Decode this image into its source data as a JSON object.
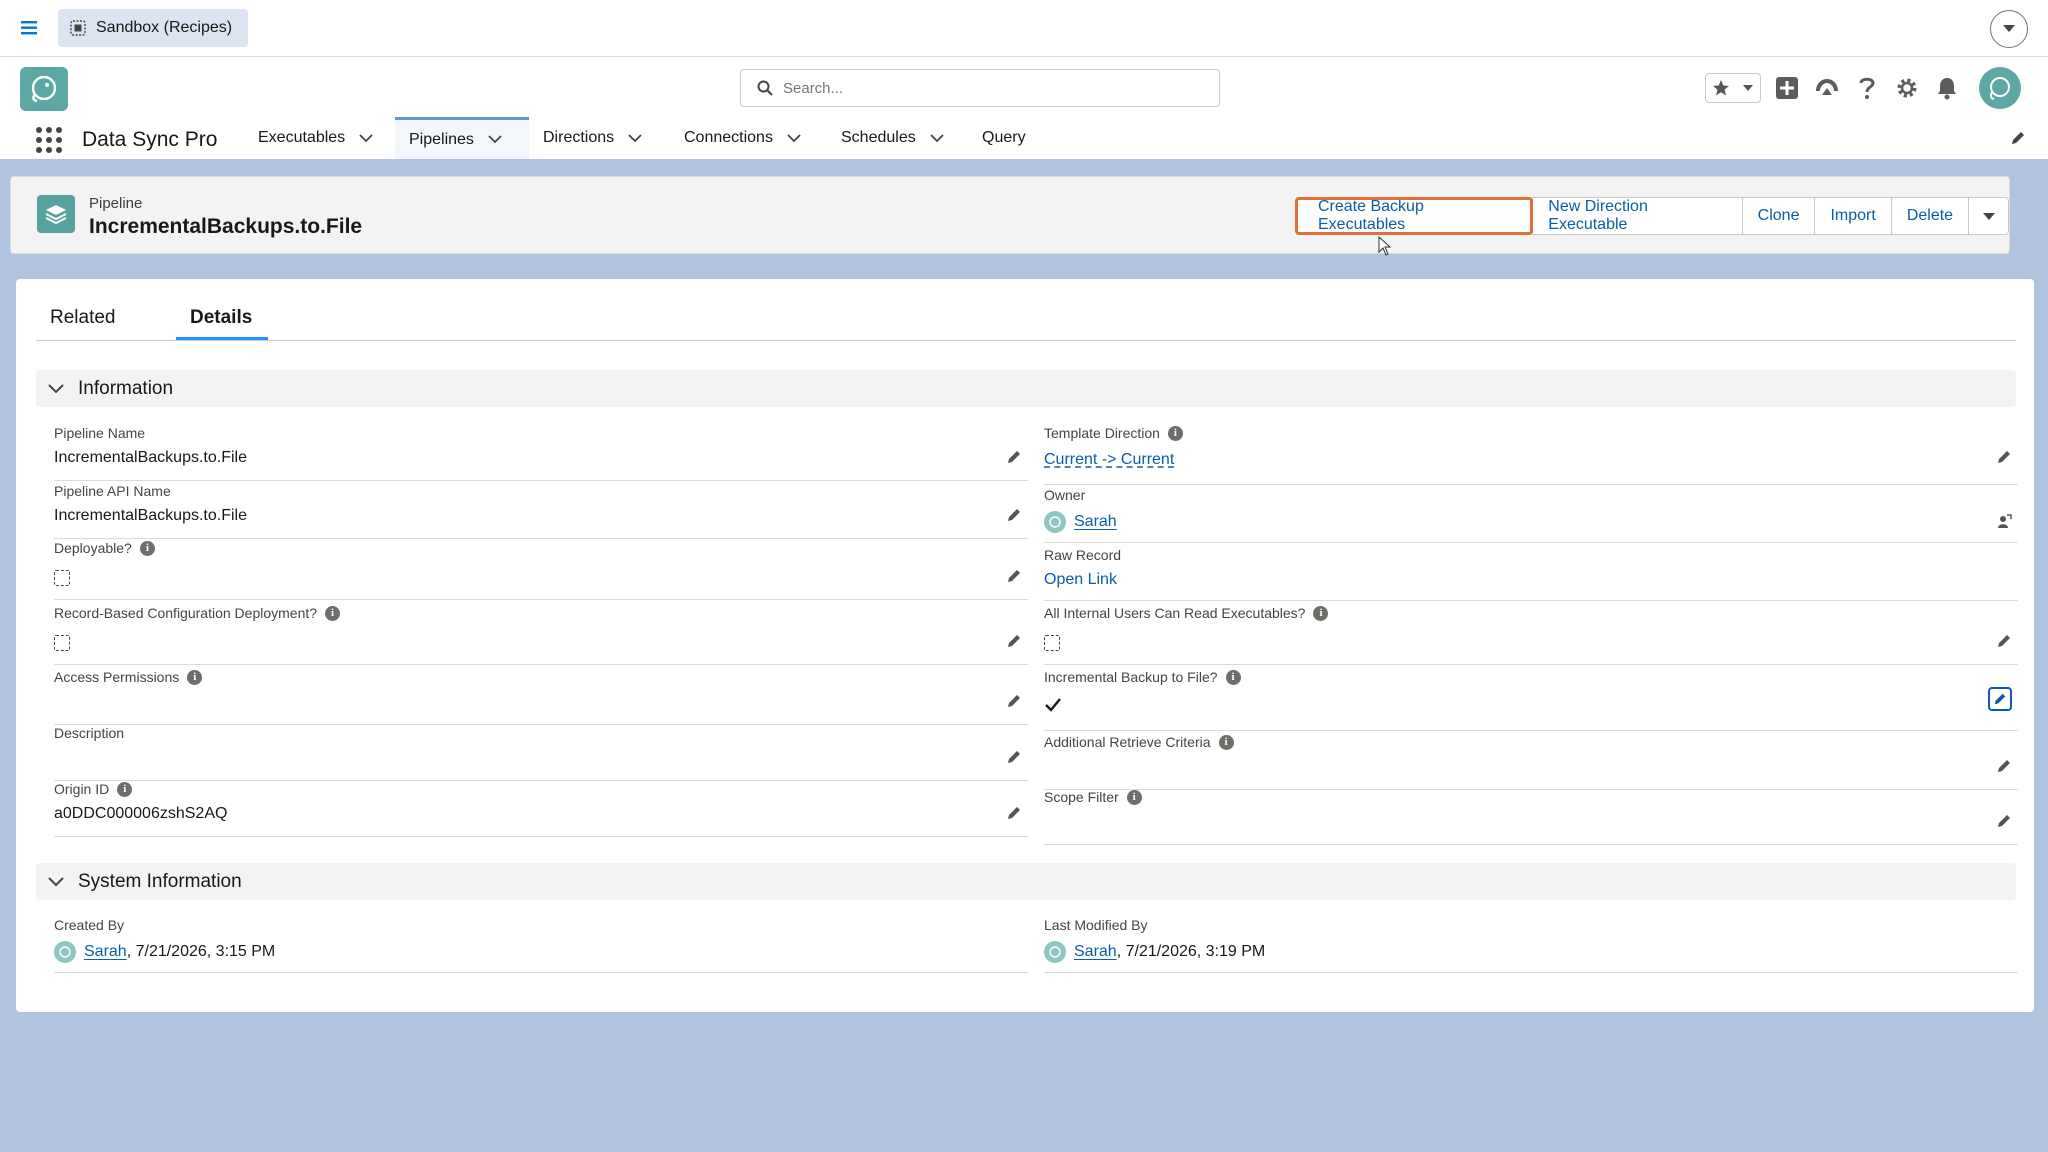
{
  "topbar": {
    "org_label": "Sandbox (Recipes)"
  },
  "header": {
    "search_placeholder": "Search..."
  },
  "nav": {
    "app_name": "Data Sync Pro",
    "tabs": [
      {
        "label": "Executables",
        "dropdown": true
      },
      {
        "label": "Pipelines",
        "dropdown": true,
        "active": true
      },
      {
        "label": "Directions",
        "dropdown": true
      },
      {
        "label": "Connections",
        "dropdown": true
      },
      {
        "label": "Schedules",
        "dropdown": true
      },
      {
        "label": "Query",
        "dropdown": false
      }
    ]
  },
  "record": {
    "object_label": "Pipeline",
    "title": "IncrementalBackups.to.File",
    "actions": {
      "create_backup": "Create Backup Executables",
      "new_direction": "New Direction Executable",
      "clone": "Clone",
      "import": "Import",
      "delete": "Delete"
    }
  },
  "tabs": {
    "related": "Related",
    "details": "Details"
  },
  "information": {
    "title": "Information",
    "left": {
      "pipeline_name": {
        "label": "Pipeline Name",
        "value": "IncrementalBackups.to.File"
      },
      "pipeline_api_name": {
        "label": "Pipeline API Name",
        "value": "IncrementalBackups.to.File"
      },
      "deployable": {
        "label": "Deployable?",
        "checked": false
      },
      "record_based": {
        "label": "Record-Based Configuration Deployment?",
        "checked": false
      },
      "access_permissions": {
        "label": "Access Permissions",
        "value": ""
      },
      "description": {
        "label": "Description",
        "value": ""
      },
      "origin_id": {
        "label": "Origin ID",
        "value": "a0DDC000006zshS2AQ"
      }
    },
    "right": {
      "template_direction": {
        "label": "Template Direction",
        "value": "Current -> Current"
      },
      "owner": {
        "label": "Owner",
        "value": "Sarah"
      },
      "raw_record": {
        "label": "Raw Record",
        "value": "Open Link"
      },
      "all_internal": {
        "label": "All Internal Users Can Read Executables?",
        "checked": false
      },
      "incremental_backup": {
        "label": "Incremental Backup to File?",
        "checked": true
      },
      "additional_retrieve": {
        "label": "Additional Retrieve Criteria",
        "value": ""
      },
      "scope_filter": {
        "label": "Scope Filter",
        "value": ""
      }
    }
  },
  "system_information": {
    "title": "System Information",
    "created_by": {
      "label": "Created By",
      "user": "Sarah",
      "date": ", 7/21/2026, 3:15 PM"
    },
    "last_modified_by": {
      "label": "Last Modified By",
      "user": "Sarah",
      "date": ", 7/21/2026, 3:19 PM"
    }
  },
  "colors": {
    "link": "#0b5cab",
    "highlight": "#e2703b",
    "brand": "#5ba8a5",
    "background": "#b0c4df"
  }
}
